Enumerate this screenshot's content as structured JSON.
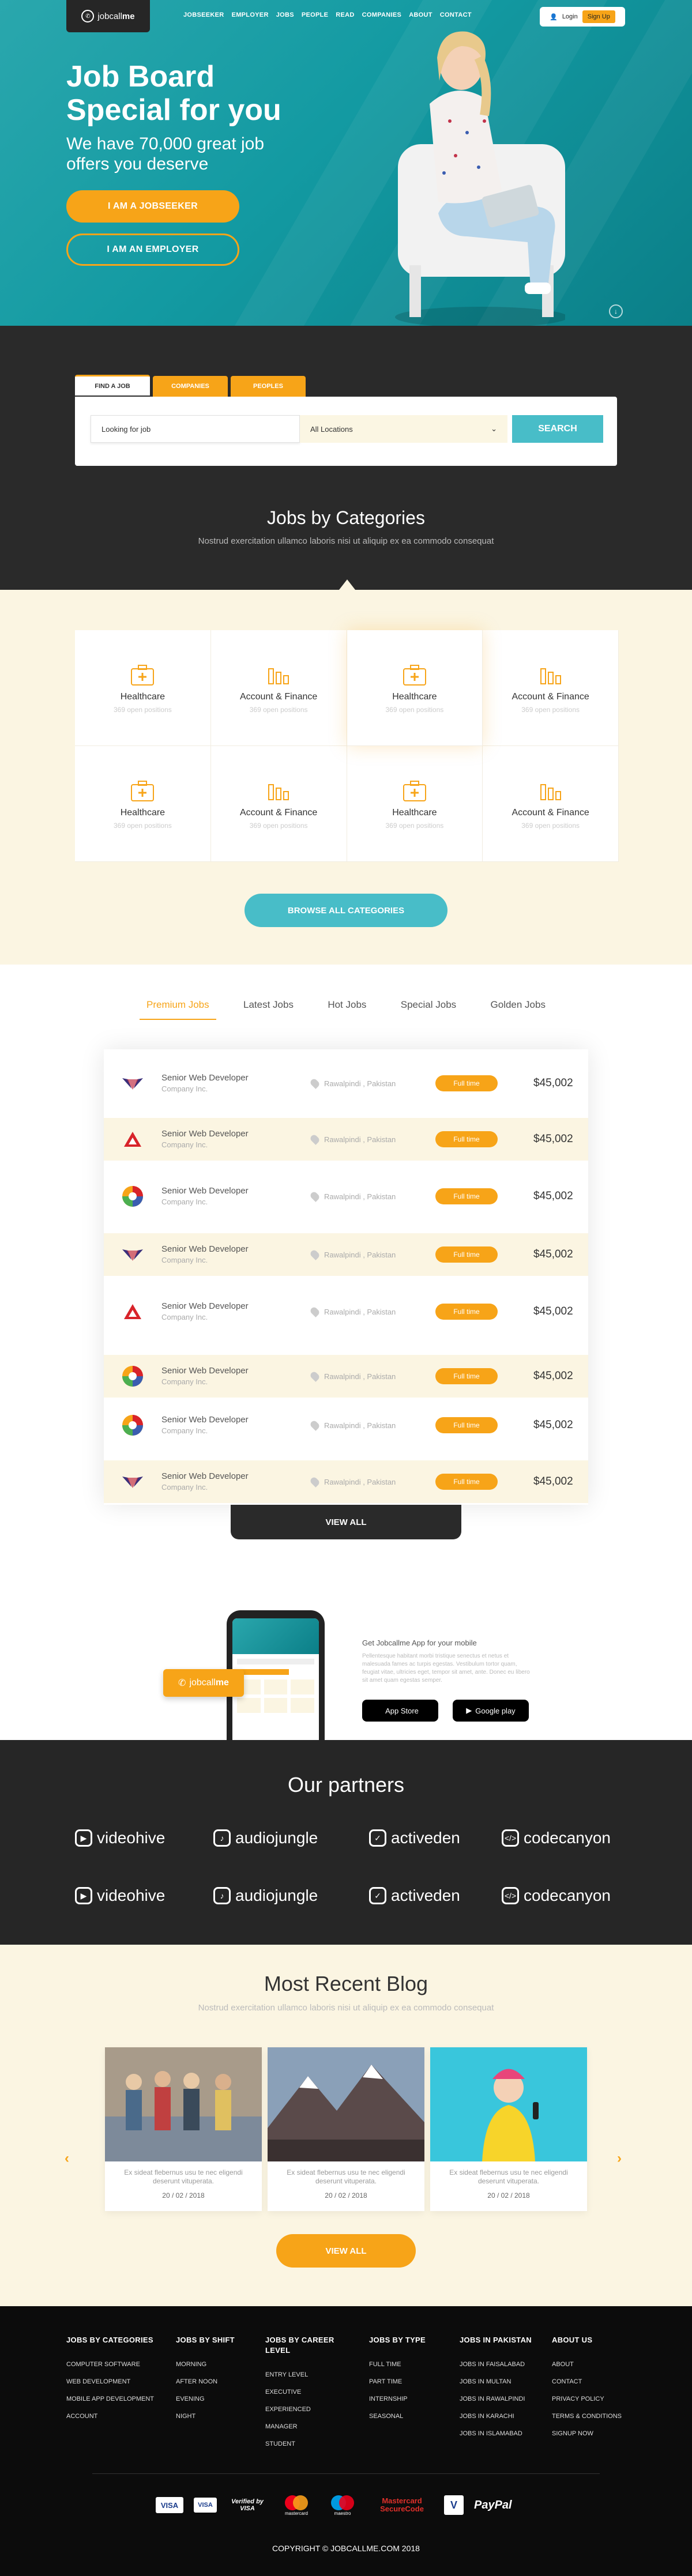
{
  "header": {
    "logo_text": "jobcall",
    "logo_bold": "me",
    "nav": [
      "JOBSEEKER",
      "EMPLOYER",
      "JOBS",
      "PEOPLE",
      "READ",
      "COMPANIES",
      "ABOUT",
      "CONTACT"
    ],
    "login": "Login",
    "signup": "Sign Up"
  },
  "hero": {
    "title_line1": "Job Board",
    "title_line2": "Special for you",
    "subtitle": "We have 70,000 great job offers you deserve",
    "btn_jobseeker": "I AM A JOBSEEKER",
    "btn_employer": "I AM AN EMPLOYER"
  },
  "search": {
    "tabs": [
      "FIND A JOB",
      "COMPANIES",
      "PEOPLES"
    ],
    "input_value": "Looking for job",
    "location": "All Locations",
    "button": "SEARCH"
  },
  "categories": {
    "title": "Jobs by Categories",
    "subtitle": "Nostrud exercitation ullamco laboris nisi ut aliquip ex ea commodo consequat",
    "items": [
      {
        "name": "Healthcare",
        "count": "369 open positions",
        "icon": "medical-briefcase-icon"
      },
      {
        "name": "Account & Finance",
        "count": "369 open positions",
        "icon": "bar-chart-icon"
      },
      {
        "name": "Healthcare",
        "count": "369 open positions",
        "icon": "medical-briefcase-icon"
      },
      {
        "name": "Account & Finance",
        "count": "369 open positions",
        "icon": "bar-chart-icon"
      },
      {
        "name": "Healthcare",
        "count": "369 open positions",
        "icon": "medical-briefcase-icon"
      },
      {
        "name": "Account & Finance",
        "count": "369 open positions",
        "icon": "bar-chart-icon"
      },
      {
        "name": "Healthcare",
        "count": "369 open positions",
        "icon": "medical-briefcase-icon"
      },
      {
        "name": "Account & Finance",
        "count": "369 open positions",
        "icon": "bar-chart-icon"
      }
    ],
    "browse": "BROWSE ALL CATEGORIES"
  },
  "jobs": {
    "tabs": [
      "Premium Jobs",
      "Latest Jobs",
      "Hot Jobs",
      "Special Jobs",
      "Golden Jobs"
    ],
    "rows": [
      {
        "title": "Senior Web Developer",
        "company": "Company Inc.",
        "location": "Rawalpindi , Pakistan",
        "type": "Full time",
        "salary": "$45,002",
        "logo": "wings"
      },
      {
        "title": "Senior Web Developer",
        "company": "Company Inc.",
        "location": "Rawalpindi , Pakistan",
        "type": "Full time",
        "salary": "$45,002",
        "logo": "triangle"
      },
      {
        "title": "Senior Web Developer",
        "company": "Company Inc.",
        "location": "Rawalpindi , Pakistan",
        "type": "Full time",
        "salary": "$45,002",
        "logo": "circle"
      },
      {
        "title": "Senior Web Developer",
        "company": "Company Inc.",
        "location": "Rawalpindi , Pakistan",
        "type": "Full time",
        "salary": "$45,002",
        "logo": "wings"
      },
      {
        "title": "Senior Web Developer",
        "company": "Company Inc.",
        "location": "Rawalpindi , Pakistan",
        "type": "Full time",
        "salary": "$45,002",
        "logo": "triangle"
      },
      {
        "title": "Senior Web Developer",
        "company": "Company Inc.",
        "location": "Rawalpindi , Pakistan",
        "type": "Full time",
        "salary": "$45,002",
        "logo": "circle"
      },
      {
        "title": "Senior Web Developer",
        "company": "Company Inc.",
        "location": "Rawalpindi , Pakistan",
        "type": "Full time",
        "salary": "$45,002",
        "logo": "circle"
      },
      {
        "title": "Senior Web Developer",
        "company": "Company Inc.",
        "location": "Rawalpindi , Pakistan",
        "type": "Full time",
        "salary": "$45,002",
        "logo": "wings"
      }
    ],
    "view_all": "VIEW ALL"
  },
  "app": {
    "title": "Get Jobcallme App for your mobile",
    "desc": "Pellentesque habitant morbi tristique senectus et netus et malesuada fames ac turpis egestas. Vestibulum tortor quam, feugiat vitae, ultricies eget, tempor sit amet, ante. Donec eu libero sit amet quam egestas semper.",
    "badge_text": "jobcall",
    "badge_bold": "me",
    "appstore": "App Store",
    "googleplay": "Google play"
  },
  "partners": {
    "title": "Our partners",
    "items": [
      "videohive",
      "audiojungle",
      "activeden",
      "codecanyon",
      "videohive",
      "audiojungle",
      "activeden",
      "codecanyon"
    ]
  },
  "blog": {
    "title": "Most Recent Blog",
    "subtitle": "Nostrud exercitation ullamco laboris nisi ut aliquip ex ea commodo consequat",
    "posts": [
      {
        "text": "Ex sideat flebernus usu te nec eligendi deserunt vituperata.",
        "date": "20 / 02 / 2018"
      },
      {
        "text": "Ex sideat flebernus usu te nec eligendi deserunt vituperata.",
        "date": "20 / 02 / 2018"
      },
      {
        "text": "Ex sideat flebernus usu te nec eligendi deserunt vituperata.",
        "date": "20 / 02 / 2018"
      }
    ],
    "view_all": "VIEW ALL"
  },
  "footer": {
    "cols": [
      {
        "title": "JOBS BY CATEGORIES",
        "items": [
          "COMPUTER SOFTWARE",
          "WEB DEVELOPMENT",
          "MOBILE APP DEVELOPMENT",
          "ACCOUNT"
        ]
      },
      {
        "title": "JOBS BY SHIFT",
        "items": [
          "MORNING",
          "AFTER NOON",
          "EVENING",
          "NIGHT"
        ]
      },
      {
        "title": "JOBS BY CAREER LEVEL",
        "items": [
          "ENTRY LEVEL",
          "EXECUTIVE",
          "EXPERIENCED",
          "MANAGER",
          "STUDENT"
        ]
      },
      {
        "title": "JOBS BY TYPE",
        "items": [
          "FULL TIME",
          "PART TIME",
          "INTERNSHIP",
          "SEASONAL"
        ]
      },
      {
        "title": "JOBS IN PAKISTAN",
        "items": [
          "JOBS IN FAISALABAD",
          "JOBS IN MULTAN",
          "JOBS IN RAWALPINDI",
          "JOBS IN KARACHI",
          "JOBS IN ISLAMABAD"
        ]
      },
      {
        "title": "ABOUT US",
        "items": [
          "ABOUT",
          "CONTACT",
          "PRIVACY POLICY",
          "TERMS & CONDITIONS",
          "SIGNUP NOW"
        ]
      }
    ],
    "payments": [
      "VISA",
      "VISA",
      "Verified by VISA",
      "mastercard",
      "maestro",
      "Mastercard SecureCode",
      "V",
      "PayPal"
    ],
    "copyright": "COPYRIGHT © JOBCALLME.COM 2018"
  },
  "colors": {
    "accent": "#f7a418",
    "teal": "#48bdc8",
    "dark": "#2a2a2a",
    "cream": "#fbf5e2"
  }
}
